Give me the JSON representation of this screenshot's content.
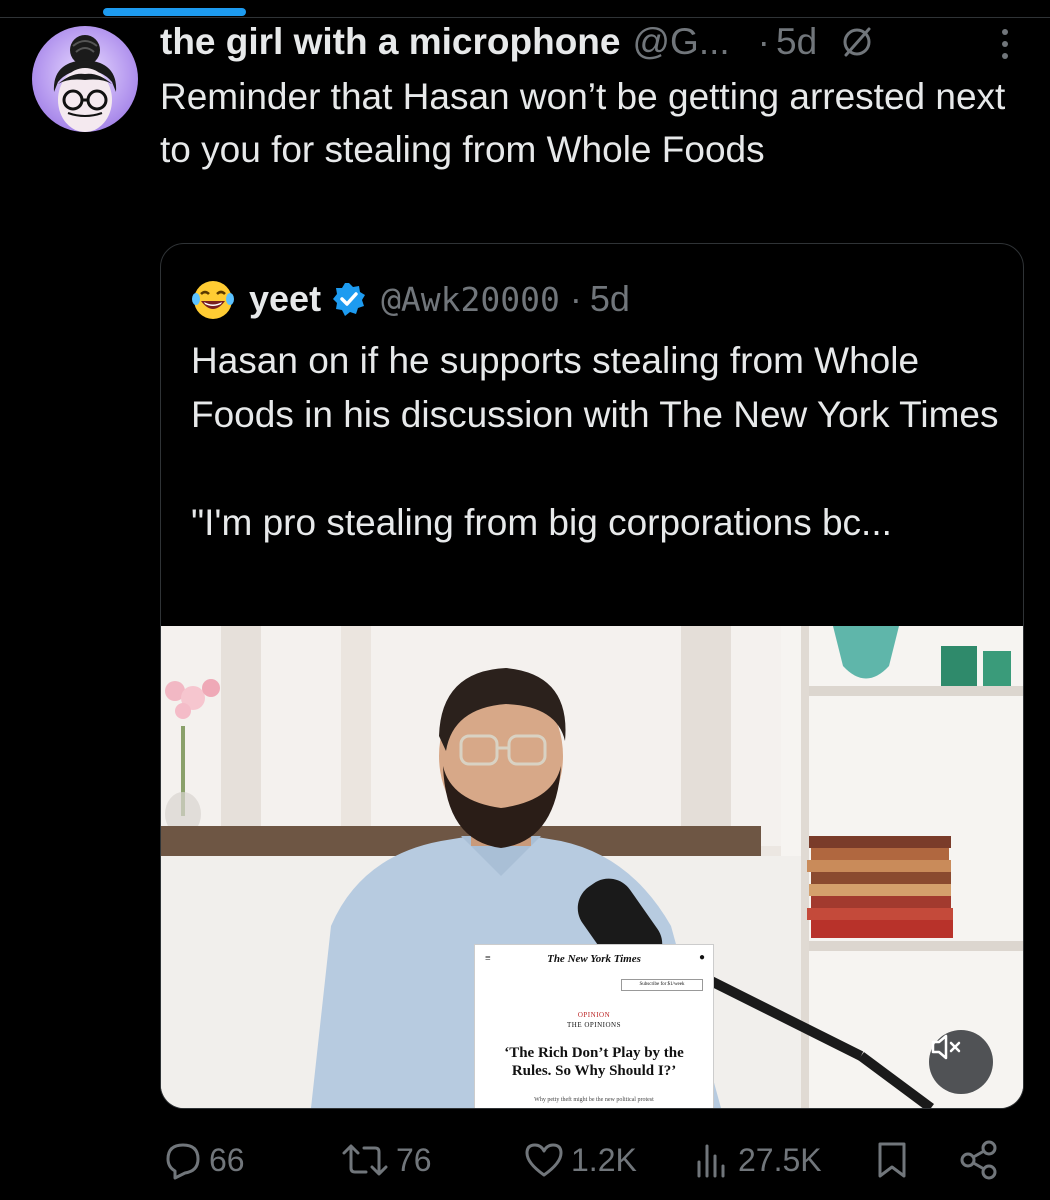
{
  "tweet": {
    "author_name": "the girl with a microphone",
    "author_handle": "@G...",
    "separator": "·",
    "time": "5d",
    "text": "Reminder that Hasan won’t be getting arrested next to you for stealing from Whole Foods",
    "status_icon": "muted-circle-icon"
  },
  "quote": {
    "emoji": "joy-emoji",
    "author_name": "yeet",
    "author_handle": "@Awk20000",
    "separator": "·",
    "time": "5d",
    "text": "Hasan on if he supports stealing from Whole Foods in his discussion with The New York Times\n\n\"I'm pro stealing from big corporations bc...",
    "media": {
      "nyt_masthead": "The New York Times",
      "nyt_subscribe": "Subscribe for $1/week",
      "nyt_section": "OPINION",
      "nyt_series": "THE OPINIONS",
      "nyt_headline": "‘The Rich Don’t Play by the Rules. So Why Should I?’",
      "nyt_dek": "Why petty theft might be the new political protest",
      "mute_icon": "volume-muted-icon"
    }
  },
  "actions": {
    "replies": "66",
    "reposts": "76",
    "likes": "1.2K",
    "views": "27.5K"
  },
  "colors": {
    "background": "#000000",
    "text": "#e7e9ea",
    "secondary": "#71767b",
    "border": "#2f3336",
    "accent": "#1d9bf0"
  }
}
